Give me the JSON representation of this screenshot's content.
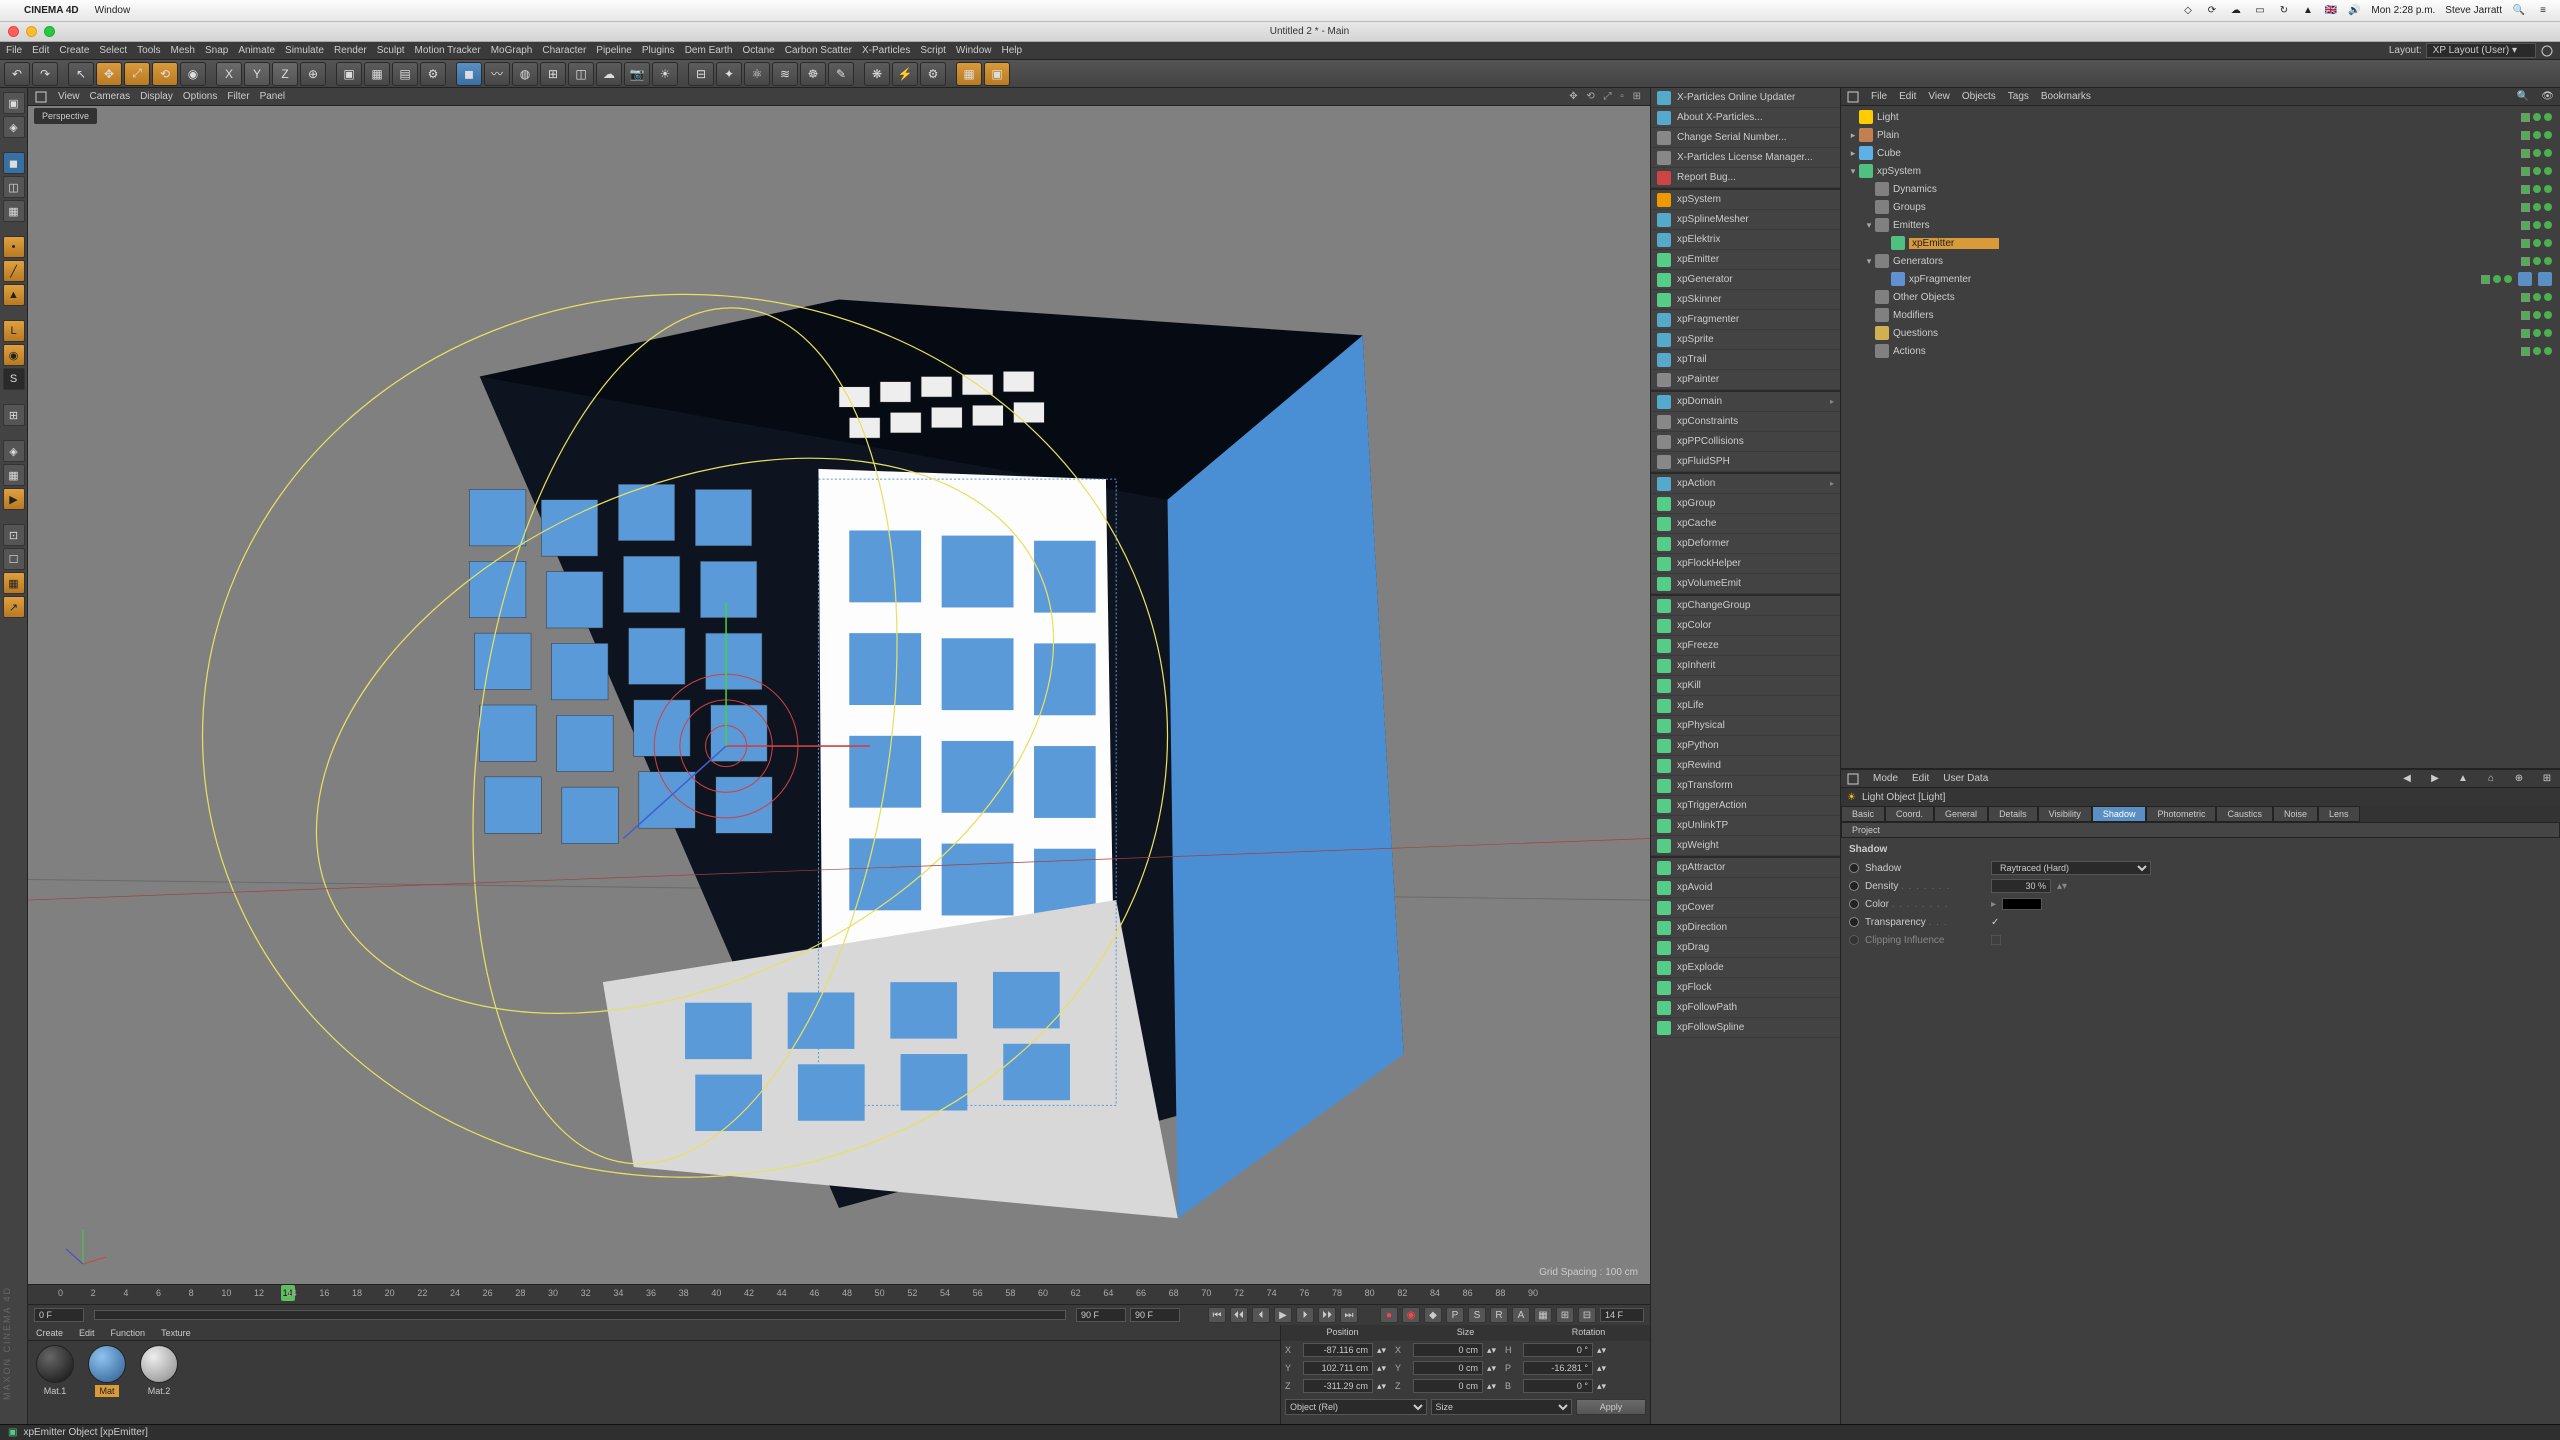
{
  "mac_menu": {
    "app": "CINEMA 4D",
    "items": [
      "Window"
    ],
    "right_user": "Steve Jarratt",
    "time": "Mon 2:28 p.m.",
    "lang": "🇬🇧"
  },
  "titlebar": {
    "title": "Untitled 2 * - Main"
  },
  "app_menu": [
    "File",
    "Edit",
    "Create",
    "Select",
    "Tools",
    "Mesh",
    "Snap",
    "Animate",
    "Simulate",
    "Render",
    "Sculpt",
    "Motion Tracker",
    "MoGraph",
    "Character",
    "Pipeline",
    "Plugins",
    "Dem Earth",
    "Octane",
    "Carbon Scatter",
    "X-Particles",
    "Script",
    "Window",
    "Help"
  ],
  "layout_label": "Layout:",
  "layout_value": "XP Layout (User)",
  "viewport_menu": [
    "View",
    "Cameras",
    "Display",
    "Options",
    "Filter",
    "Panel"
  ],
  "viewport_tag": "Perspective",
  "grid_spacing": "Grid Spacing : 100 cm",
  "obj_menu": [
    "File",
    "Edit",
    "View",
    "Objects",
    "Tags",
    "Bookmarks"
  ],
  "attr_menu": [
    "Mode",
    "Edit",
    "User Data"
  ],
  "attr_title": "Light Object [Light]",
  "attr_tabs_row1": [
    "Basic",
    "Coord.",
    "General",
    "Details",
    "Visibility",
    "Shadow",
    "Photometric",
    "Caustics",
    "Noise",
    "Lens"
  ],
  "attr_tabs_row2": [
    "Project"
  ],
  "attr_active_tab": "Shadow",
  "attr": {
    "section": "Shadow",
    "shadow_type": "Raytraced (Hard)",
    "density": "30 %",
    "color_label": "Color",
    "transparency_label": "Transparency",
    "transparency_checked": true,
    "clipping_label": "Clipping Influence",
    "shadow_label": "Shadow",
    "density_label": "Density"
  },
  "objects": [
    {
      "indent": 0,
      "icon": "#ffcc00",
      "label": "Light",
      "toggle": ""
    },
    {
      "indent": 0,
      "icon": "#c08050",
      "label": "Plain",
      "toggle": "▸"
    },
    {
      "indent": 0,
      "icon": "#60b0e8",
      "label": "Cube",
      "toggle": "▸"
    },
    {
      "indent": 0,
      "icon": "#50c080",
      "label": "xpSystem",
      "toggle": "▾",
      "sel": false
    },
    {
      "indent": 1,
      "icon": "#808080",
      "label": "Dynamics",
      "toggle": ""
    },
    {
      "indent": 1,
      "icon": "#808080",
      "label": "Groups",
      "toggle": ""
    },
    {
      "indent": 1,
      "icon": "#808080",
      "label": "Emitters",
      "toggle": "▾"
    },
    {
      "indent": 2,
      "icon": "#50c080",
      "label": "xpEmitter",
      "toggle": "",
      "sel": true
    },
    {
      "indent": 1,
      "icon": "#808080",
      "label": "Generators",
      "toggle": "▾"
    },
    {
      "indent": 2,
      "icon": "#6090d0",
      "label": "xpFragmenter",
      "toggle": "",
      "tags": 2
    },
    {
      "indent": 1,
      "icon": "#808080",
      "label": "Other Objects",
      "toggle": ""
    },
    {
      "indent": 1,
      "icon": "#808080",
      "label": "Modifiers",
      "toggle": ""
    },
    {
      "indent": 1,
      "icon": "#d0b050",
      "label": "Questions",
      "toggle": ""
    },
    {
      "indent": 1,
      "icon": "#808080",
      "label": "Actions",
      "toggle": ""
    }
  ],
  "plugin_groups": [
    [
      {
        "label": "X-Particles Online Updater",
        "c": "#5ac"
      },
      {
        "label": "About X-Particles...",
        "c": "#5ac"
      },
      {
        "label": "Change Serial Number...",
        "c": "#888"
      },
      {
        "label": "X-Particles License Manager...",
        "c": "#888"
      },
      {
        "label": "Report Bug...",
        "c": "#c44"
      }
    ],
    [
      {
        "label": "xpSystem",
        "c": "#e90"
      },
      {
        "label": "xpSplineMesher",
        "c": "#5ac"
      },
      {
        "label": "xpElektrix",
        "c": "#5ac"
      },
      {
        "label": "xpEmitter",
        "c": "#5c8"
      },
      {
        "label": "xpGenerator",
        "c": "#5c8"
      },
      {
        "label": "xpSkinner",
        "c": "#5c8"
      },
      {
        "label": "xpFragmenter",
        "c": "#5ac"
      },
      {
        "label": "xpSprite",
        "c": "#5ac"
      },
      {
        "label": "xpTrail",
        "c": "#5ac"
      },
      {
        "label": "xpPainter",
        "c": "#888"
      }
    ],
    [
      {
        "label": "xpDomain",
        "c": "#5ac",
        "arrow": true
      },
      {
        "label": "xpConstraints",
        "c": "#888"
      },
      {
        "label": "xpPPCollisions",
        "c": "#888"
      },
      {
        "label": "xpFluidSPH",
        "c": "#888"
      }
    ],
    [
      {
        "label": "xpAction",
        "c": "#5ac",
        "arrow": true
      },
      {
        "label": "xpGroup",
        "c": "#5c8"
      },
      {
        "label": "xpCache",
        "c": "#5c8"
      },
      {
        "label": "xpDeformer",
        "c": "#5c8"
      },
      {
        "label": "xpFlockHelper",
        "c": "#5c8"
      },
      {
        "label": "xpVolumeEmit",
        "c": "#5c8"
      }
    ],
    [
      {
        "label": "xpChangeGroup",
        "c": "#5c8"
      },
      {
        "label": "xpColor",
        "c": "#5c8"
      },
      {
        "label": "xpFreeze",
        "c": "#5c8"
      },
      {
        "label": "xpInherit",
        "c": "#5c8"
      },
      {
        "label": "xpKill",
        "c": "#5c8"
      },
      {
        "label": "xpLife",
        "c": "#5c8"
      },
      {
        "label": "xpPhysical",
        "c": "#5c8"
      },
      {
        "label": "xpPython",
        "c": "#5c8"
      },
      {
        "label": "xpRewind",
        "c": "#5c8"
      },
      {
        "label": "xpTransform",
        "c": "#5c8"
      },
      {
        "label": "xpTriggerAction",
        "c": "#5c8"
      },
      {
        "label": "xpUnlinkTP",
        "c": "#5c8"
      },
      {
        "label": "xpWeight",
        "c": "#5c8"
      }
    ],
    [
      {
        "label": "xpAttractor",
        "c": "#5c8"
      },
      {
        "label": "xpAvoid",
        "c": "#5c8"
      },
      {
        "label": "xpCover",
        "c": "#5c8"
      },
      {
        "label": "xpDirection",
        "c": "#5c8"
      },
      {
        "label": "xpDrag",
        "c": "#5c8"
      },
      {
        "label": "xpExplode",
        "c": "#5c8"
      },
      {
        "label": "xpFlock",
        "c": "#5c8"
      },
      {
        "label": "xpFollowPath",
        "c": "#5c8"
      },
      {
        "label": "xpFollowSpline",
        "c": "#5c8"
      }
    ]
  ],
  "timeline": {
    "start_field": "0 F",
    "current_field": "14 F",
    "end_field": "90 F",
    "end_field2": "90 F",
    "cursor": 14,
    "range": [
      0,
      90
    ]
  },
  "materials": {
    "tabs": [
      "Create",
      "Edit",
      "Function",
      "Texture"
    ],
    "items": [
      {
        "name": "Mat.1",
        "color": "radial-gradient(circle at 35% 30%, #666, #111)"
      },
      {
        "name": "Mat",
        "color": "radial-gradient(circle at 35% 30%, #8fc3ef, #2a5c90)",
        "sel": true
      },
      {
        "name": "Mat.2",
        "color": "radial-gradient(circle at 35% 30%, #eee, #888)"
      }
    ]
  },
  "coord": {
    "headers": [
      "Position",
      "Size",
      "Rotation"
    ],
    "rows": [
      {
        "axis": "X",
        "pos": "-87.116 cm",
        "saxis": "X",
        "size": "0 cm",
        "raxis": "H",
        "rot": "0 °"
      },
      {
        "axis": "Y",
        "pos": "102.711 cm",
        "saxis": "Y",
        "size": "0 cm",
        "raxis": "P",
        "rot": "-16.281 °"
      },
      {
        "axis": "Z",
        "pos": "-311.29 cm",
        "saxis": "Z",
        "size": "0 cm",
        "raxis": "B",
        "rot": "0 °"
      }
    ],
    "mode1": "Object (Rel)",
    "mode2": "Size",
    "apply": "Apply"
  },
  "status": "xpEmitter Object [xpEmitter]",
  "side_logo": "MAXON CINEMA 4D"
}
